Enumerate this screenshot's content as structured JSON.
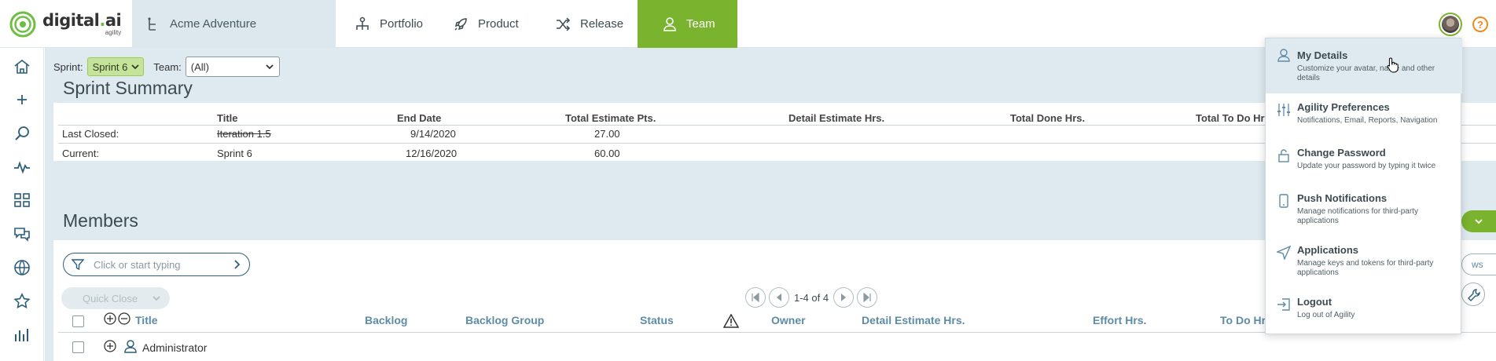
{
  "brand": {
    "name_prefix": "digital",
    "name_dot": ".",
    "name_suffix": "ai",
    "sub": "agility"
  },
  "header": {
    "project": "Acme Adventure",
    "tabs": [
      {
        "label": "Portfolio",
        "icon": "portfolio-icon"
      },
      {
        "label": "Product",
        "icon": "rocket-icon"
      },
      {
        "label": "Release",
        "icon": "shuffle-icon"
      },
      {
        "label": "Team",
        "icon": "person-icon",
        "active": true
      }
    ],
    "help": "?"
  },
  "filters": {
    "sprint_label": "Sprint:",
    "sprint_value": "Sprint 6",
    "team_label": "Team:",
    "team_value": "(All)"
  },
  "sprint_summary": {
    "title": "Sprint Summary",
    "columns": [
      "Title",
      "End Date",
      "Total Estimate Pts.",
      "Detail Estimate Hrs.",
      "Total Done Hrs.",
      "Total To Do Hr"
    ],
    "rows": [
      {
        "label": "Last Closed:",
        "title": "Iteration 1.5",
        "end_date": "9/14/2020",
        "estimate": "27.00"
      },
      {
        "label": "Current:",
        "title": "Sprint 6",
        "end_date": "12/16/2020",
        "estimate": "60.00"
      }
    ]
  },
  "members": {
    "title": "Members",
    "search_placeholder": "Click or start typing",
    "quick_close": "Quick Close",
    "pager_text": "1-4 of 4",
    "columns": [
      "Title",
      "Backlog",
      "Backlog Group",
      "Status",
      "Owner",
      "Detail Estimate Hrs.",
      "Effort Hrs.",
      "To Do Hr"
    ],
    "rows": [
      {
        "title": "Administrator"
      }
    ],
    "side_button_partial": "ws"
  },
  "user_menu": {
    "items": [
      {
        "label": "My Details",
        "desc": "Customize your avatar, name and other details",
        "icon": "user-icon"
      },
      {
        "label": "Agility Preferences",
        "desc": "Notifications, Email, Reports, Navigation",
        "icon": "sliders-icon"
      },
      {
        "label": "Change Password",
        "desc": "Update your password by typing it twice",
        "icon": "lock-icon"
      },
      {
        "label": "Push Notifications",
        "desc": "Manage notifications for third-party applications",
        "icon": "phone-icon"
      },
      {
        "label": "Applications",
        "desc": "Manage keys and tokens for third-party applications",
        "icon": "send-icon"
      },
      {
        "label": "Logout",
        "desc": "Log out of Agility",
        "icon": "logout-icon"
      }
    ]
  },
  "colors": {
    "accent": "#7ab32e",
    "link": "#5d8ba8",
    "background": "#dfeaf0"
  }
}
